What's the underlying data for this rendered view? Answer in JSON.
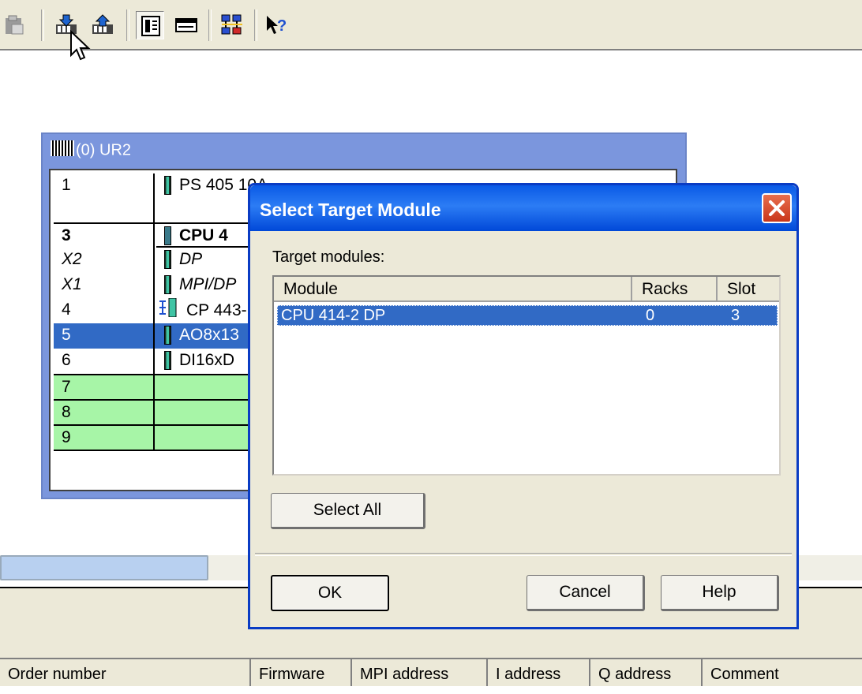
{
  "toolbar": {
    "icons": [
      "paste-icon",
      "download-to-module-icon",
      "upload-to-pg-icon",
      "catalog-icon",
      "module-view-icon",
      "network-icon",
      "context-help-icon"
    ]
  },
  "rack": {
    "title": "(0) UR2",
    "rows": [
      {
        "slot": "1",
        "module": "PS 405 10A"
      },
      {
        "slot": "3",
        "module": "CPU 4"
      },
      {
        "slot": "X2",
        "module": "DP"
      },
      {
        "slot": "X1",
        "module": "MPI/DP"
      },
      {
        "slot": "4",
        "module": "CP 443-"
      },
      {
        "slot": "5",
        "module": "AO8x13"
      },
      {
        "slot": "6",
        "module": "DI16xD"
      },
      {
        "slot": "7",
        "module": ""
      },
      {
        "slot": "8",
        "module": ""
      },
      {
        "slot": "9",
        "module": ""
      }
    ],
    "colors": {
      "selected": "#316ac5",
      "empty_slot": "#a7f5a7"
    }
  },
  "bottom_table": {
    "headers": [
      "Order number",
      "Firmware",
      "MPI address",
      "I address",
      "Q address",
      "Comment"
    ]
  },
  "dialog": {
    "title": "Select Target Module",
    "label": "Target  modules:",
    "columns": [
      "Module",
      "Racks",
      "Slot"
    ],
    "rows": [
      {
        "module": "CPU 414-2 DP",
        "racks": "0",
        "slot": "3"
      }
    ],
    "select_all": "Select All",
    "ok": "OK",
    "cancel": "Cancel",
    "help": "Help"
  }
}
